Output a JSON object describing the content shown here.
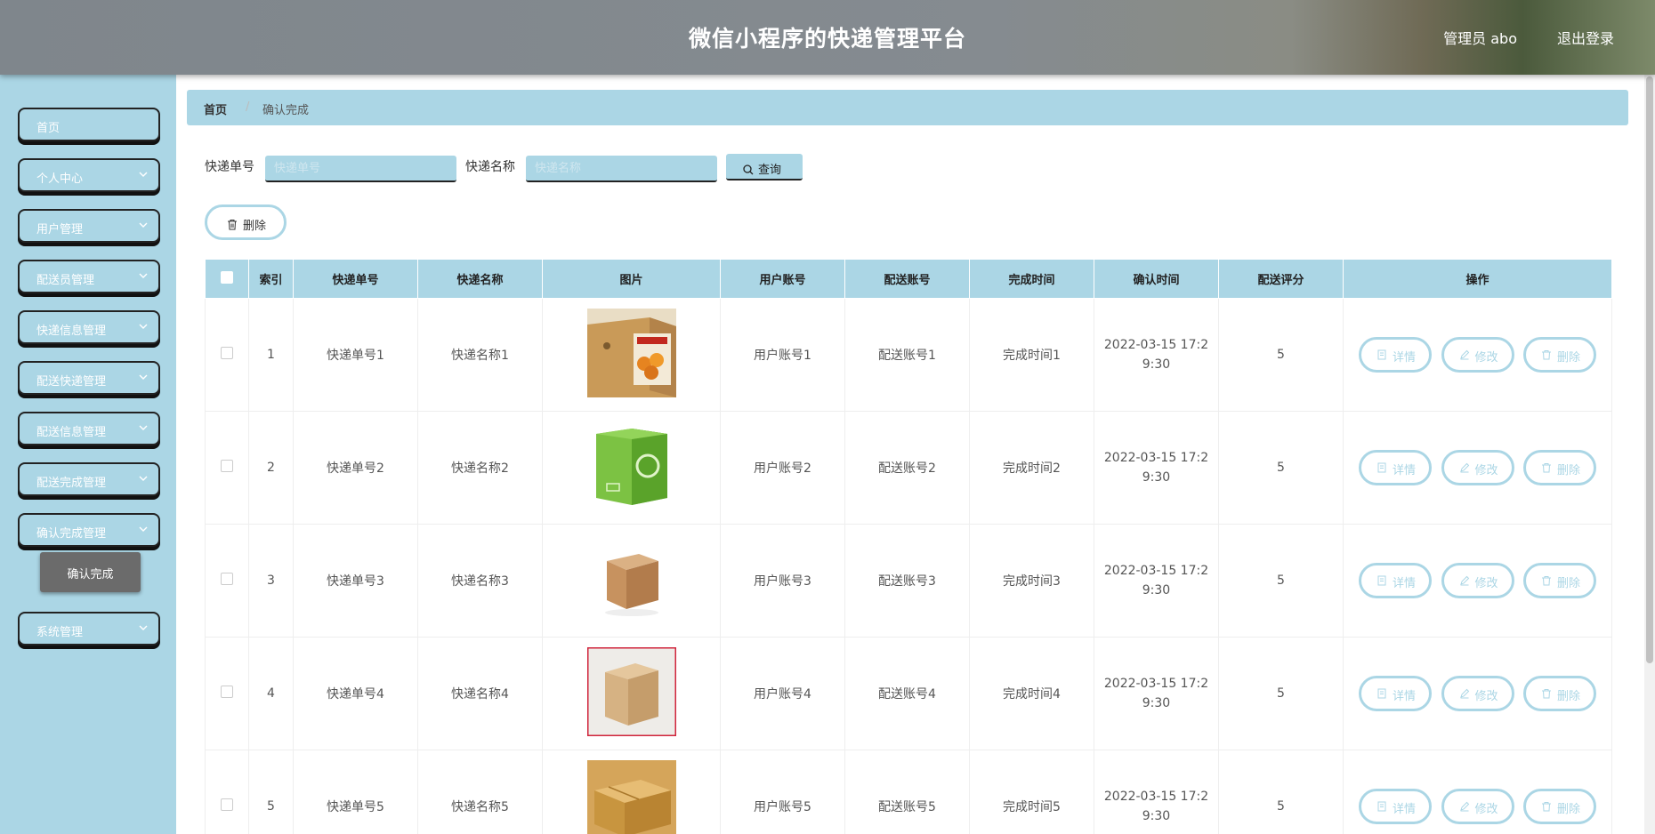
{
  "header": {
    "title": "微信小程序的快递管理平台",
    "user": "管理员 abo",
    "logout": "退出登录"
  },
  "sidebar": {
    "items": [
      {
        "label": "首页",
        "chevron": false
      },
      {
        "label": "个人中心",
        "chevron": true
      },
      {
        "label": "用户管理",
        "chevron": true
      },
      {
        "label": "配送员管理",
        "chevron": true
      },
      {
        "label": "快递信息管理",
        "chevron": true
      },
      {
        "label": "配送快递管理",
        "chevron": true
      },
      {
        "label": "配送信息管理",
        "chevron": true
      },
      {
        "label": "配送完成管理",
        "chevron": true
      },
      {
        "label": "确认完成管理",
        "chevron": true
      },
      {
        "label": "系统管理",
        "chevron": true
      }
    ],
    "submenu_active": "确认完成"
  },
  "breadcrumb": {
    "home": "首页",
    "separator": "/",
    "current": "确认完成"
  },
  "search": {
    "field1_label": "快递单号",
    "field1_placeholder": "快递单号",
    "field2_label": "快递名称",
    "field2_placeholder": "快递名称",
    "query_label": "查询"
  },
  "toolbar": {
    "delete_label": "删除"
  },
  "table": {
    "headers": [
      "索引",
      "快递单号",
      "快递名称",
      "图片",
      "用户账号",
      "配送账号",
      "完成时间",
      "确认时间",
      "配送评分",
      "操作"
    ],
    "rows": [
      {
        "index": "1",
        "tracking": "快递单号1",
        "name": "快递名称1",
        "image": "box-with-orange-label",
        "user": "用户账号1",
        "courier": "配送账号1",
        "done": "完成时间1",
        "confirm_line1": "2022-03-15 17:2",
        "confirm_line2": "9:30",
        "score": "5"
      },
      {
        "index": "2",
        "tracking": "快递单号2",
        "name": "快递名称2",
        "image": "green-recycle-box",
        "user": "用户账号2",
        "courier": "配送账号2",
        "done": "完成时间2",
        "confirm_line1": "2022-03-15 17:2",
        "confirm_line2": "9:30",
        "score": "5"
      },
      {
        "index": "3",
        "tracking": "快递单号3",
        "name": "快递名称3",
        "image": "small-cardboard-box",
        "user": "用户账号3",
        "courier": "配送账号3",
        "done": "完成时间3",
        "confirm_line1": "2022-03-15 17:2",
        "confirm_line2": "9:30",
        "score": "5"
      },
      {
        "index": "4",
        "tracking": "快递单号4",
        "name": "快递名称4",
        "image": "cardboard-box-red-border",
        "user": "用户账号4",
        "courier": "配送账号4",
        "done": "完成时间4",
        "confirm_line1": "2022-03-15 17:2",
        "confirm_line2": "9:30",
        "score": "5"
      },
      {
        "index": "5",
        "tracking": "快递单号5",
        "name": "快递名称5",
        "image": "flat-cardboard-box",
        "user": "用户账号5",
        "courier": "配送账号5",
        "done": "完成时间5",
        "confirm_line1": "2022-03-15 17:2",
        "confirm_line2": "9:30",
        "score": "5"
      }
    ],
    "actions": {
      "detail": "详情",
      "edit": "修改",
      "delete": "删除"
    }
  },
  "colors": {
    "accent": "#abd6e5",
    "submenu_bg": "#6b6b6b",
    "header_bg": "#858b90"
  }
}
